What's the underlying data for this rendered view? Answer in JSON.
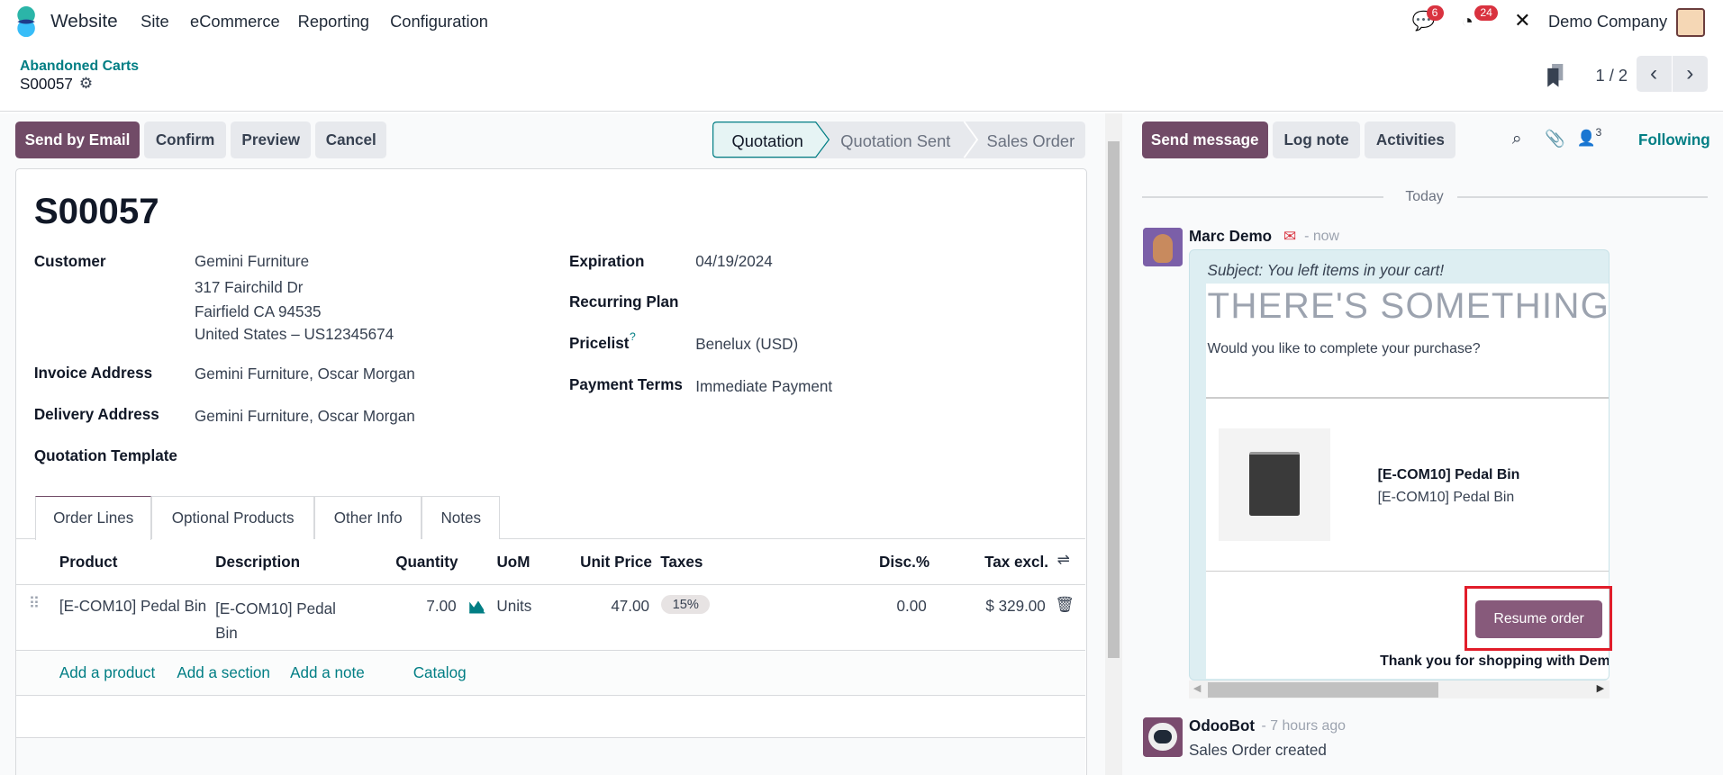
{
  "navbar": {
    "app": "Website",
    "menus": [
      "Site",
      "eCommerce",
      "Reporting",
      "Configuration"
    ],
    "messages_count": "6",
    "activities_count": "24",
    "company": "Demo Company"
  },
  "control_panel": {
    "breadcrumb": "Abandoned Carts",
    "record": "S00057",
    "pager": "1 / 2"
  },
  "actions": {
    "send_email": "Send by Email",
    "confirm": "Confirm",
    "preview": "Preview",
    "cancel": "Cancel"
  },
  "statusbar": {
    "stages": [
      "Quotation",
      "Quotation Sent",
      "Sales Order"
    ],
    "active": "Quotation"
  },
  "form": {
    "title": "S00057",
    "customer_label": "Customer",
    "customer": [
      "Gemini Furniture",
      "317 Fairchild Dr",
      "Fairfield CA 94535",
      "United States – US12345674"
    ],
    "invoice_label": "Invoice Address",
    "invoice": "Gemini Furniture, Oscar Morgan",
    "delivery_label": "Delivery Address",
    "delivery": "Gemini Furniture, Oscar Morgan",
    "template_label": "Quotation Template",
    "expiration_label": "Expiration",
    "expiration": "04/19/2024",
    "recurring_label": "Recurring Plan",
    "pricelist_label": "Pricelist",
    "pricelist_help": "?",
    "pricelist": "Benelux (USD)",
    "terms_label": "Payment Terms",
    "terms": "Immediate Payment"
  },
  "tabs": [
    "Order Lines",
    "Optional Products",
    "Other Info",
    "Notes"
  ],
  "order_lines": {
    "headers": {
      "product": "Product",
      "description": "Description",
      "quantity": "Quantity",
      "uom": "UoM",
      "unit_price": "Unit Price",
      "taxes": "Taxes",
      "disc": "Disc.%",
      "subtotal": "Tax excl."
    },
    "rows": [
      {
        "product": "[E-COM10] Pedal Bin",
        "description": "[E-COM10] Pedal Bin",
        "quantity": "7.00",
        "uom": "Units",
        "unit_price": "47.00",
        "taxes": "15%",
        "disc": "0.00",
        "subtotal": "$ 329.00"
      }
    ],
    "add_product": "Add a product",
    "add_section": "Add a section",
    "add_note": "Add a note",
    "catalog": "Catalog"
  },
  "chatter": {
    "send_message": "Send message",
    "log_note": "Log note",
    "activities": "Activities",
    "followers_count": "3",
    "following": "Following",
    "date_divider": "Today",
    "messages": [
      {
        "author": "Marc Demo",
        "time": "- now",
        "subject": "Subject: You left items in your cart!",
        "heading": "THERE'S SOMETHING IN",
        "intro": "Would you like to complete your purchase?",
        "product_name": "[E-COM10] Pedal Bin",
        "product_desc": "[E-COM10] Pedal Bin",
        "button": "Resume order",
        "footer": "Thank you for shopping with Demo Company"
      },
      {
        "author": "OdooBot",
        "time": "- 7 hours ago",
        "body": "Sales Order created"
      }
    ]
  },
  "colors": {
    "primary": "#714b67",
    "link": "#017e84",
    "badge": "#d9323f",
    "highlight": "#e11d2a"
  }
}
